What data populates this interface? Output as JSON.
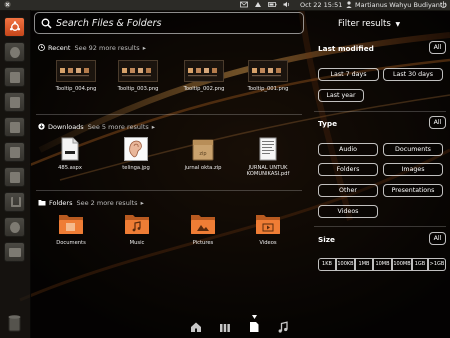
{
  "panel": {
    "clock": "Oct 22 15:51",
    "user": "Martianus Wahyu Budiyanto"
  },
  "search": {
    "placeholder": "Search Files & Folders"
  },
  "recent": {
    "title": "Recent",
    "more": "See 92 more results",
    "items": [
      {
        "caption": "Tooltip_004.png",
        "icon": "image-thumbnail"
      },
      {
        "caption": "Tooltip_003.png",
        "icon": "image-thumbnail"
      },
      {
        "caption": "Tooltip_002.png",
        "icon": "image-thumbnail"
      },
      {
        "caption": "Tooltip_001.png",
        "icon": "image-thumbnail"
      }
    ]
  },
  "downloads": {
    "title": "Downloads",
    "more": "See 5 more results",
    "items": [
      {
        "caption": "485.aspx",
        "icon": "document-icon"
      },
      {
        "caption": "telinga.jpg",
        "icon": "ear-image-icon"
      },
      {
        "caption": "jurnal okta.zip",
        "icon": "zip-package-icon"
      },
      {
        "caption": "JURNAL UNTUK KOMUNIKASI.pdf",
        "icon": "pdf-document-icon"
      }
    ]
  },
  "folders": {
    "title": "Folders",
    "more": "See 2 more results",
    "items": [
      {
        "caption": "Documents",
        "icon": "documents-folder-icon"
      },
      {
        "caption": "Music",
        "icon": "music-folder-icon"
      },
      {
        "caption": "Pictures",
        "icon": "pictures-folder-icon"
      },
      {
        "caption": "Videos",
        "icon": "videos-folder-icon"
      }
    ]
  },
  "filter": {
    "header": "Filter results",
    "last_modified": {
      "title": "Last modified",
      "all": "All",
      "options": [
        "Last 7 days",
        "Last 30 days",
        "Last year"
      ]
    },
    "type": {
      "title": "Type",
      "all": "All",
      "options": [
        "Audio",
        "Documents",
        "Folders",
        "Images",
        "Other",
        "Presentations",
        "Videos"
      ]
    },
    "size": {
      "title": "Size",
      "all": "All",
      "options": [
        "1KB",
        "100KB",
        "1MB",
        "10MB",
        "100MB",
        "1GB",
        ">1GB"
      ]
    }
  },
  "lens_bar": [
    "home-lens-icon",
    "applications-lens-icon",
    "files-lens-icon",
    "music-lens-icon"
  ],
  "colors": {
    "accent": "#e95420",
    "folder_orange": "#ef7d35",
    "background": "#0c0906"
  }
}
